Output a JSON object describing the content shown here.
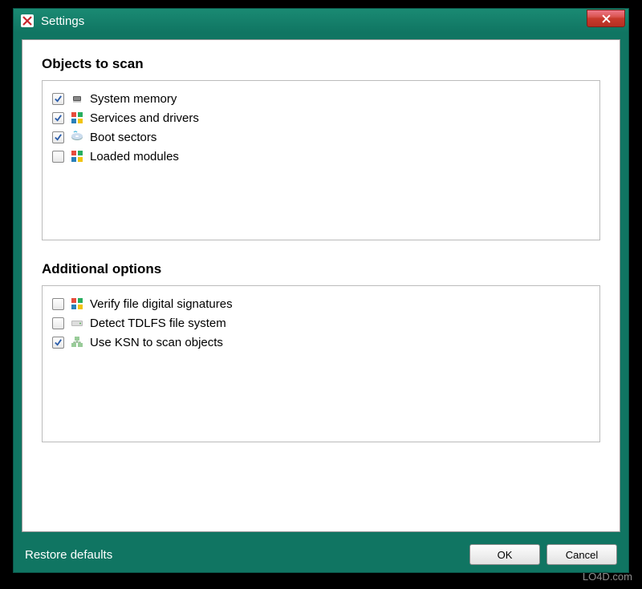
{
  "window": {
    "title": "Settings"
  },
  "sections": {
    "objects": {
      "title": "Objects to scan",
      "items": [
        {
          "label": "System memory",
          "checked": true,
          "icon": "chip"
        },
        {
          "label": "Services and drivers",
          "checked": true,
          "icon": "windows"
        },
        {
          "label": "Boot sectors",
          "checked": true,
          "icon": "disk"
        },
        {
          "label": "Loaded modules",
          "checked": false,
          "icon": "windows"
        }
      ]
    },
    "additional": {
      "title": "Additional options",
      "items": [
        {
          "label": "Verify file digital signatures",
          "checked": false,
          "icon": "windows"
        },
        {
          "label": "Detect TDLFS file system",
          "checked": false,
          "icon": "hdd"
        },
        {
          "label": "Use KSN to scan objects",
          "checked": true,
          "icon": "network"
        }
      ]
    }
  },
  "footer": {
    "restore": "Restore defaults",
    "ok": "OK",
    "cancel": "Cancel"
  },
  "watermark": "LO4D.com"
}
